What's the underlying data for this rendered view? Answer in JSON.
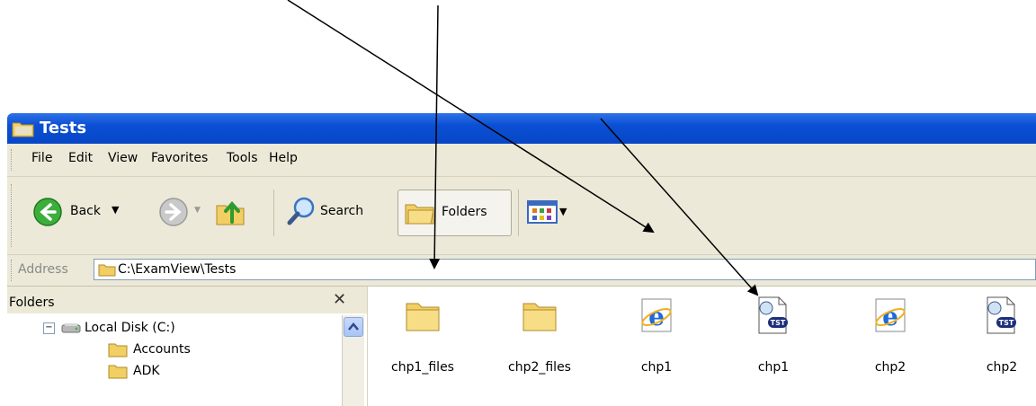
{
  "window": {
    "title": "Tests"
  },
  "menu": [
    "File",
    "Edit",
    "View",
    "Favorites",
    "Tools",
    "Help"
  ],
  "toolbar": {
    "back_label": "Back",
    "search_label": "Search",
    "folders_label": "Folders"
  },
  "address": {
    "label": "Address",
    "value": "C:\\ExamView\\Tests"
  },
  "folders_pane": {
    "title": "Folders",
    "tree": [
      {
        "label": "Local Disk (C:)",
        "icon": "drive-icon"
      },
      {
        "label": "Accounts",
        "icon": "folder-icon"
      },
      {
        "label": "ADK",
        "icon": "folder-icon"
      }
    ]
  },
  "files": [
    {
      "label": "chp1_files",
      "icon": "folder-icon"
    },
    {
      "label": "chp2_files",
      "icon": "folder-icon"
    },
    {
      "label": "chp1",
      "icon": "ie-icon"
    },
    {
      "label": "chp1",
      "icon": "tst-file-icon"
    },
    {
      "label": "chp2",
      "icon": "ie-icon"
    },
    {
      "label": "chp2",
      "icon": "tst-file-icon"
    }
  ],
  "colors": {
    "title_bar": "#0a4fd4",
    "chrome": "#ece9d8",
    "folder": "#f7d675"
  }
}
